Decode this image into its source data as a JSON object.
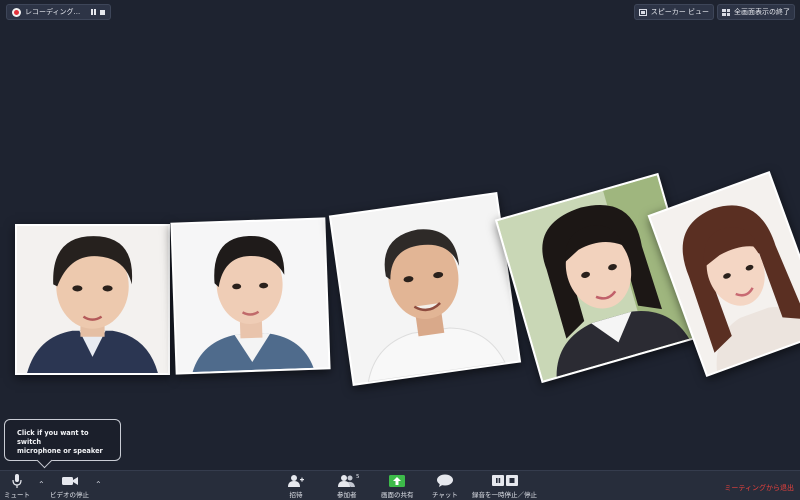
{
  "top_bar": {
    "recording_label": "レコーディング...",
    "speaker_view_label": "スピーカー ビュー",
    "fullscreen_exit_label": "全画面表示の終了"
  },
  "tooltip": {
    "line1": "Click if you want to switch",
    "line2": "microphone or speaker"
  },
  "toolbar": {
    "mute_label": "ミュート",
    "video_label": "ビデオの停止",
    "invite_label": "招待",
    "participants_label": "参加者",
    "participants_count": "5",
    "share_label": "画面の共有",
    "chat_label": "チャット",
    "record_label": "録音を一時停止／停止",
    "leave_label": "ミーティングから退出"
  },
  "colors": {
    "background": "#1e2330",
    "toolbar": "#272d3b",
    "share_green": "#3dbb4a",
    "leave_red": "#e8413d",
    "record_red": "#e2303a"
  },
  "participants": [
    {
      "icon": "participant-photo"
    },
    {
      "icon": "participant-photo"
    },
    {
      "icon": "participant-photo"
    },
    {
      "icon": "participant-photo"
    },
    {
      "icon": "participant-photo"
    }
  ]
}
